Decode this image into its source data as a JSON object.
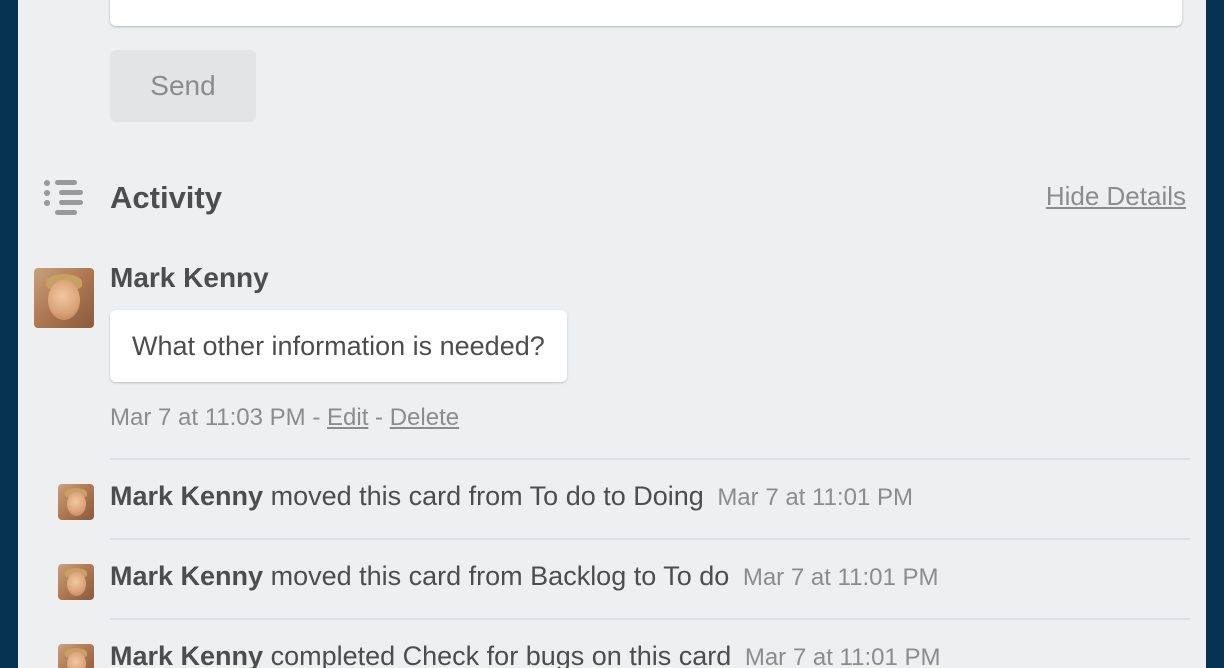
{
  "comment_form": {
    "send_label": "Send"
  },
  "activity": {
    "title": "Activity",
    "hide_details_label": "Hide Details",
    "icon": "activity-list-icon"
  },
  "comment": {
    "author": "Mark Kenny",
    "text": "What other information is needed?",
    "timestamp": "Mar 7 at 11:03 PM",
    "separator": "-",
    "edit_label": "Edit",
    "delete_label": "Delete"
  },
  "actions": [
    {
      "author": "Mark Kenny",
      "text": "moved this card from To do to Doing",
      "time": "Mar 7 at 11:01 PM"
    },
    {
      "author": "Mark Kenny",
      "text": "moved this card from Backlog to To do",
      "time": "Mar 7 at 11:01 PM"
    },
    {
      "author": "Mark Kenny",
      "text": "completed Check for bugs on this card",
      "time": "Mar 7 at 11:01 PM"
    }
  ]
}
